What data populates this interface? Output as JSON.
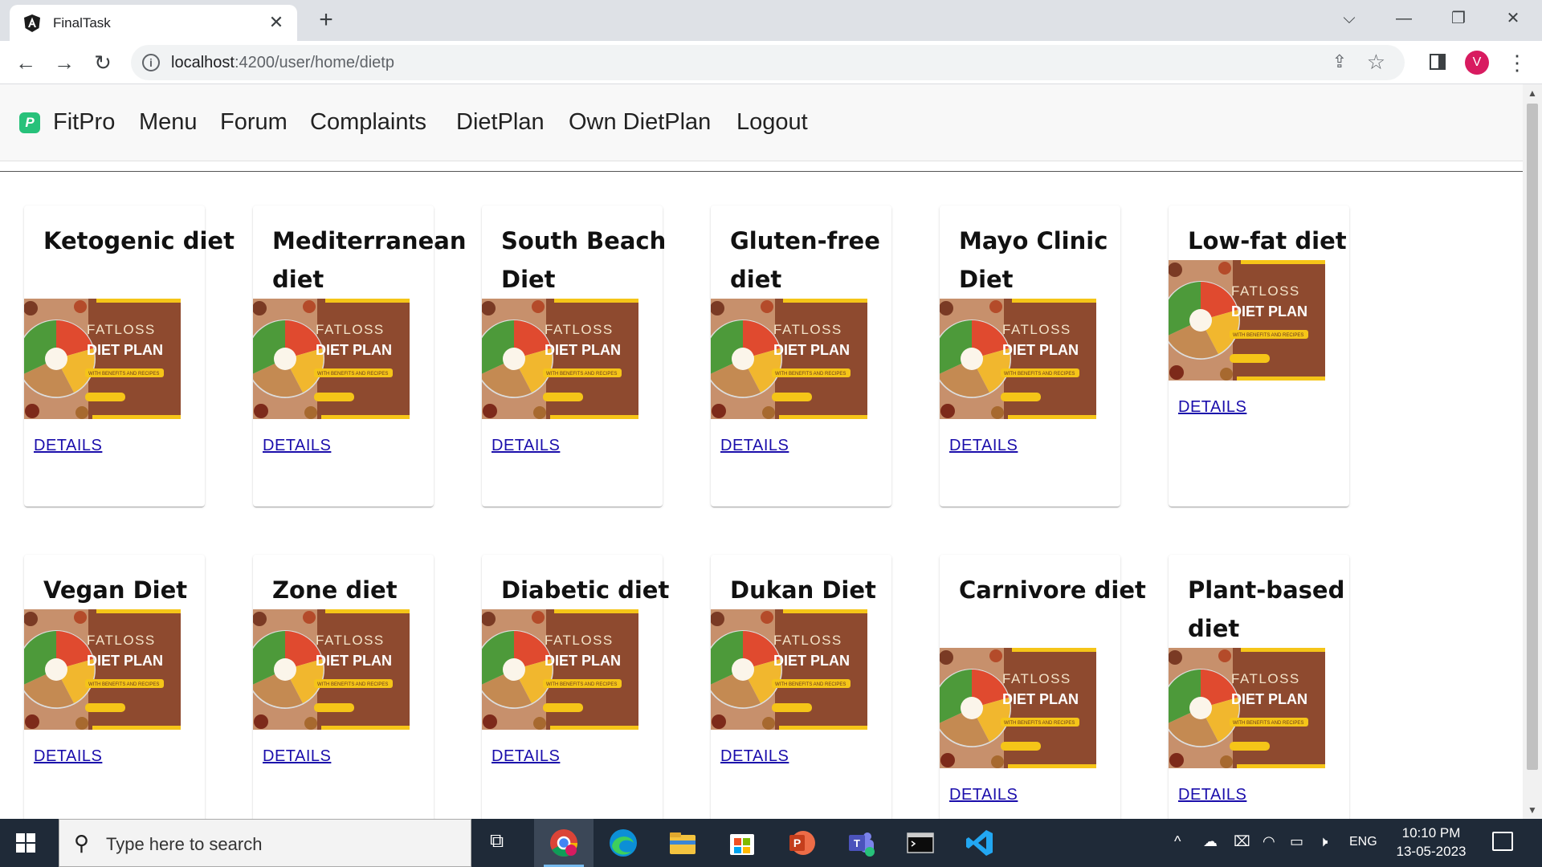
{
  "browser": {
    "tab_title": "FinalTask",
    "tab_close": "✕",
    "new_tab": "+",
    "url_host": "localhost",
    "url_path": ":4200/user/home/dietp",
    "window_controls": {
      "dropdown": "⌵",
      "minimize": "—",
      "restore": "❐",
      "close": "✕"
    },
    "profile_initial": "V"
  },
  "navbar": {
    "brand": "FitPro",
    "links": [
      "Menu",
      "Forum",
      "Complaints",
      "DietPlan",
      "Own DietPlan",
      "Logout"
    ]
  },
  "diet_image": {
    "line1": "FATLOSS",
    "line2": "DIET PLAN",
    "line3": "WITH BENEFITS AND RECIPES"
  },
  "cards": [
    {
      "title": "Ketogenic diet",
      "link": "DETAILS"
    },
    {
      "title": "Mediterranean diet",
      "link": "DETAILS"
    },
    {
      "title": "South Beach Diet",
      "link": "DETAILS"
    },
    {
      "title": "Gluten-free diet",
      "link": "DETAILS"
    },
    {
      "title": "Mayo Clinic Diet",
      "link": "DETAILS"
    },
    {
      "title": "Low-fat diet",
      "link": "DETAILS"
    },
    {
      "title": "Vegan Diet",
      "link": "DETAILS"
    },
    {
      "title": "Zone diet",
      "link": "DETAILS"
    },
    {
      "title": "Diabetic diet",
      "link": "DETAILS"
    },
    {
      "title": "Dukan Diet",
      "link": "DETAILS"
    },
    {
      "title": "Carnivore diet",
      "link": "DETAILS"
    },
    {
      "title": "Plant-based diet",
      "link": "DETAILS"
    }
  ],
  "taskbar": {
    "search_placeholder": "Type here to search",
    "language": "ENG",
    "time": "10:10 PM",
    "date": "13-05-2023"
  },
  "colors": {
    "link": "#1a0dab",
    "poster_brown": "#8e4a2f",
    "poster_yellow": "#f5c518",
    "brand_green": "#27c17a"
  }
}
